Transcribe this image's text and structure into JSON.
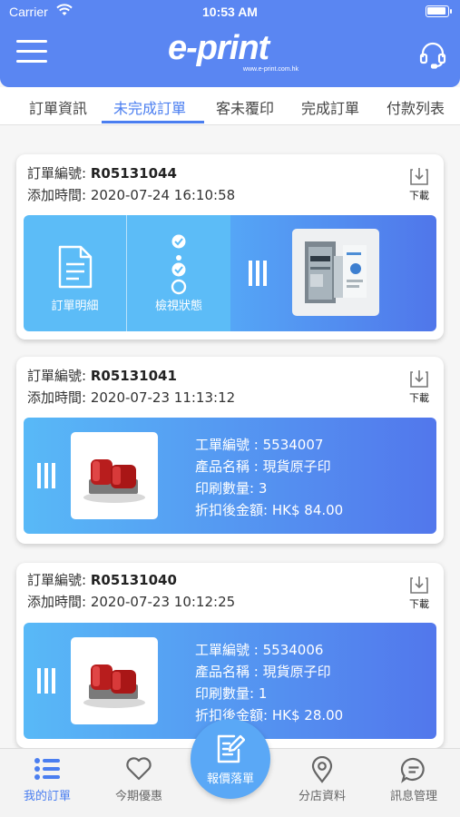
{
  "status_bar": {
    "carrier": "Carrier",
    "time": "10:53 AM"
  },
  "header": {
    "logo_text": "e-print",
    "logo_url": "www.e-print.com.hk"
  },
  "tabs": [
    {
      "label": "訂單資訊",
      "active": false
    },
    {
      "label": "未完成訂單",
      "active": true
    },
    {
      "label": "客未覆印",
      "active": false
    },
    {
      "label": "完成訂單",
      "active": false
    },
    {
      "label": "付款列表",
      "active": false
    }
  ],
  "orders": [
    {
      "order_no_label": "訂單編號:",
      "order_no": "R05131044",
      "added_label": "添加時間:",
      "added_time": "2020-07-24 16:10:58",
      "download_label": "下載",
      "actions": {
        "detail_label": "訂單明細",
        "status_label": "檢視狀態"
      },
      "thumbnail": "brochure"
    },
    {
      "order_no_label": "訂單編號:",
      "order_no": "R05131041",
      "added_label": "添加時間:",
      "added_time": "2020-07-23 11:13:12",
      "download_label": "下載",
      "job_no_label": "工單編號 :",
      "job_no": "5534007",
      "product_label": "產品名稱 :",
      "product_name": "現貨原子印",
      "qty_label": "印刷數量:",
      "qty": "3",
      "amount_label": "折扣後金額:",
      "amount": "HK$ 84.00",
      "thumbnail": "stamp"
    },
    {
      "order_no_label": "訂單編號:",
      "order_no": "R05131040",
      "added_label": "添加時間:",
      "added_time": "2020-07-23 10:12:25",
      "download_label": "下載",
      "job_no_label": "工單編號 :",
      "job_no": "5534006",
      "product_label": "產品名稱 :",
      "product_name": "現貨原子印",
      "qty_label": "印刷數量:",
      "qty": "1",
      "amount_label": "折扣後金額:",
      "amount": "HK$ 28.00",
      "thumbnail": "stamp"
    }
  ],
  "bottom_nav": {
    "items": [
      {
        "label": "我的訂單",
        "icon": "list-icon",
        "active": true
      },
      {
        "label": "今期優惠",
        "icon": "heart-icon",
        "active": false
      },
      {
        "label": "分店資料",
        "icon": "location-pin-icon",
        "active": false
      },
      {
        "label": "訊息管理",
        "icon": "chat-bubble-icon",
        "active": false
      }
    ],
    "fab_label": "報價落單"
  },
  "colors": {
    "primary": "#5a86f2",
    "accent": "#4a7ef0",
    "action": "#5cbcf7"
  }
}
